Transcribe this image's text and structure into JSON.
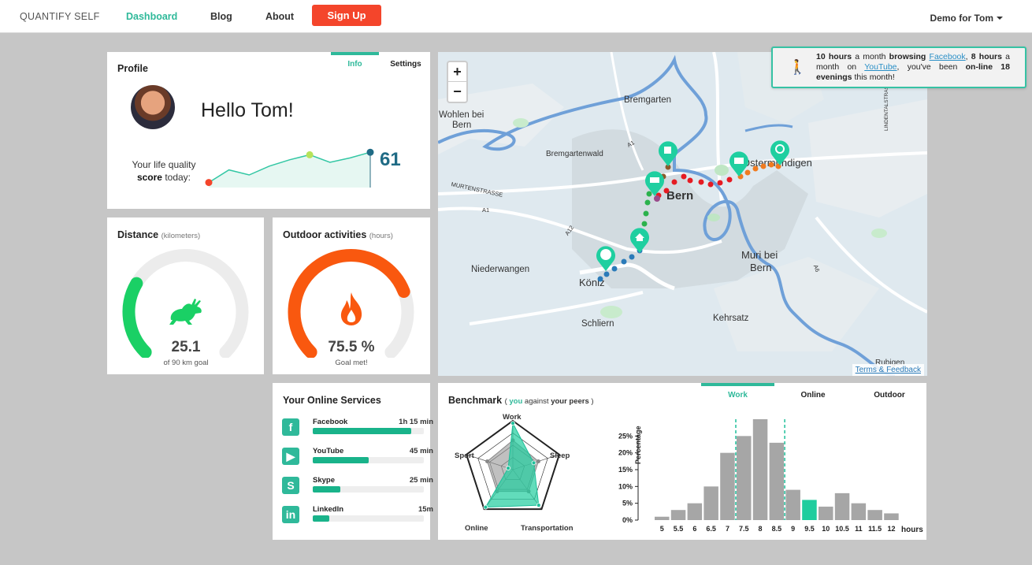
{
  "nav": {
    "brand": "QUANTIFY SELF",
    "links": [
      "Dashboard",
      "Blog",
      "About"
    ],
    "signup": "Sign Up",
    "user": "Demo for Tom"
  },
  "profile": {
    "title": "Profile",
    "tabs": [
      "Info",
      "Settings"
    ],
    "greeting": "Hello Tom!",
    "lq_line1": "Your life quality",
    "lq_bold": "score",
    "lq_rest": "today:",
    "score": "61",
    "sparkline": [
      8,
      28,
      20,
      34,
      44,
      52,
      40,
      47,
      56
    ]
  },
  "distance": {
    "title": "Distance",
    "unit": "(kilometers)",
    "value": "25.1",
    "sub": "of 90 km goal",
    "fraction": 0.279,
    "color": "#1ad065"
  },
  "outdoor": {
    "title": "Outdoor activities",
    "unit": "(hours)",
    "value": "75.5 %",
    "sub": "Goal met!",
    "fraction": 0.755,
    "color": "#f9580f"
  },
  "services": {
    "title": "Your Online Services",
    "items": [
      {
        "name": "Facebook",
        "time": "1h 15 min",
        "fill": 0.89,
        "icon": "facebook-icon",
        "glyph": "f"
      },
      {
        "name": "YouTube",
        "time": "45 min",
        "fill": 0.5,
        "icon": "youtube-icon",
        "glyph": "▶"
      },
      {
        "name": "Skype",
        "time": "25 min",
        "fill": 0.25,
        "icon": "skype-icon",
        "glyph": "S"
      },
      {
        "name": "LinkedIn",
        "time": "15m",
        "fill": 0.15,
        "icon": "linkedin-icon",
        "glyph": "in"
      }
    ]
  },
  "map": {
    "zoom_in": "+",
    "zoom_out": "−",
    "places": [
      "Bremgarten",
      "Wohlen bei",
      "Bern",
      "Bremgartenwald",
      "Bern",
      "Ostermundigen",
      "Niederwangen",
      "Köniz",
      "Muri bei",
      "Bern",
      "Schliern",
      "Kehrsatz",
      "Rubigen",
      "MURTENSTRASSE",
      "A1",
      "A12",
      "A6",
      "A1",
      "LINDENTALSTRASSE"
    ],
    "attribution": "Terms & Feedback"
  },
  "notification": {
    "p1": "10 hours",
    "p2": " a month ",
    "p3": "browsing",
    "p4": "Facebook",
    "p5": ", ",
    "p6": "8 hours",
    "p7": " a month on ",
    "p8": "YouTube",
    "p9": ", you've been ",
    "p10": "on-line 18 evenings",
    "p11": " this month!"
  },
  "benchmark": {
    "title": "Benchmark",
    "sub_open": "( ",
    "sub_you": "you",
    "sub_mid": " against ",
    "sub_peers": "your peers",
    "sub_close": " )",
    "tabs": [
      "Work",
      "Online",
      "Outdoor"
    ],
    "radar_axes": [
      "Work",
      "Sleep",
      "Transportation",
      "Online",
      "Sport"
    ],
    "ylabel": "Percentage",
    "xlabel": "hours"
  },
  "chart_data": [
    {
      "type": "bar",
      "title": "Benchmark",
      "categories": [
        "5",
        "5.5",
        "6",
        "6.5",
        "7",
        "7.5",
        "8",
        "8.5",
        "9",
        "9.5",
        "10",
        "10.5",
        "11",
        "11.5",
        "12"
      ],
      "values": [
        1,
        3,
        5,
        10,
        20,
        25,
        30,
        23,
        9,
        6,
        4,
        8,
        5,
        3,
        2
      ],
      "highlight_index": 9,
      "ylabel": "Percentage",
      "xlabel": "hours",
      "yticks": [
        "0%",
        "5%",
        "10%",
        "15%",
        "20%",
        "25%"
      ],
      "ylim": [
        0,
        30
      ],
      "colors": {
        "bar": "#a6a6a6",
        "you": "#1fcd9e",
        "marker": "#1fbf9a"
      }
    },
    {
      "type": "radar",
      "axes": [
        "Work",
        "Sleep",
        "Transportation",
        "Online",
        "Sport"
      ],
      "series": [
        {
          "name": "you",
          "values": [
            0.95,
            0.45,
            0.9,
            0.95,
            0.1
          ]
        },
        {
          "values": [
            0.6,
            0.55,
            0.55,
            0.55,
            0.55
          ]
        }
      ]
    }
  ]
}
